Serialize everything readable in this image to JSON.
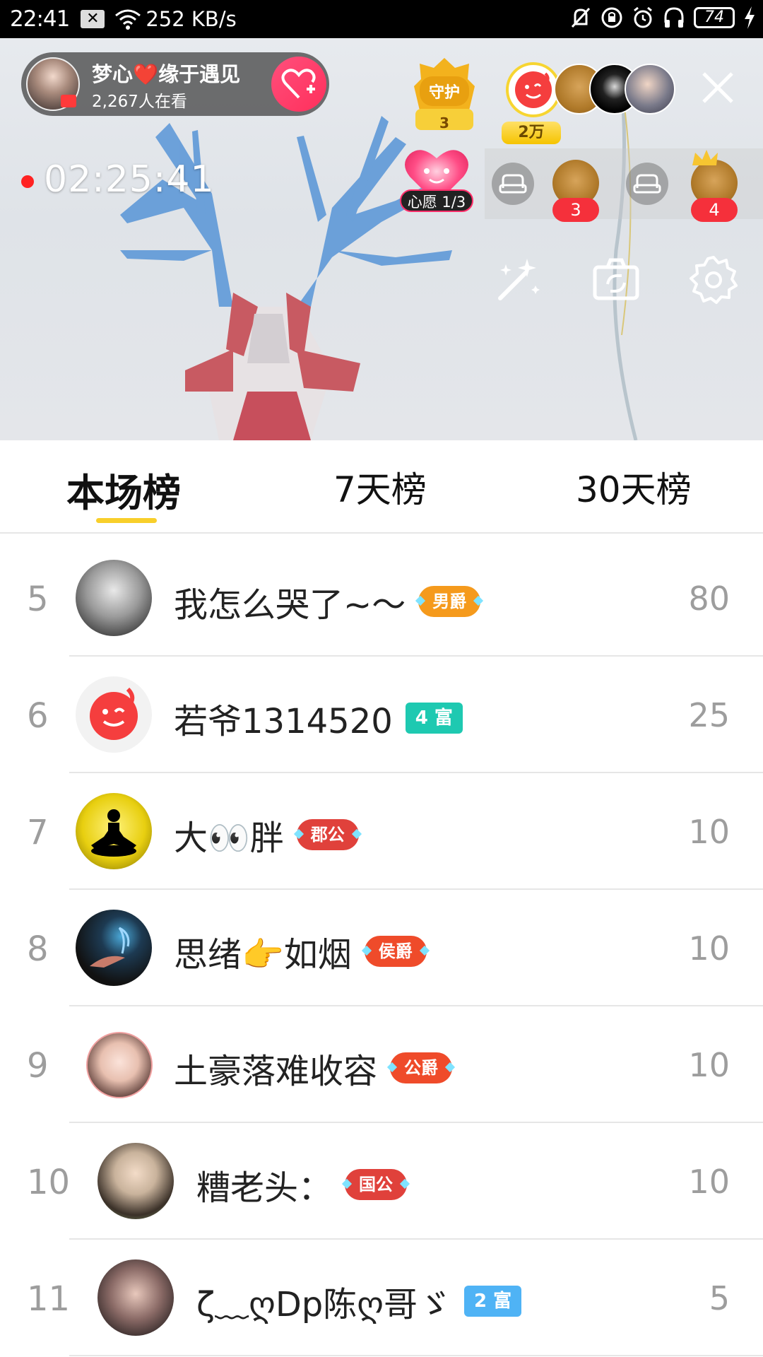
{
  "status_bar": {
    "time": "22:41",
    "network_speed": "252 KB/s",
    "battery": "74",
    "icons": [
      "close-notification-icon",
      "wifi-icon",
      "mute-icon",
      "lock-rotation-icon",
      "alarm-icon",
      "headphones-icon",
      "battery-icon",
      "charging-icon"
    ]
  },
  "live": {
    "host_name": "梦心❤️缘于遇见",
    "viewers": "2,267人在看",
    "guard": {
      "label": "守护",
      "count": "3"
    },
    "gift_tag": "2万",
    "timer": "02:25:41",
    "wish": "心愿 1/3",
    "seats": [
      {
        "type": "empty"
      },
      {
        "type": "user",
        "count": "3"
      },
      {
        "type": "empty"
      },
      {
        "type": "user",
        "count": "4"
      }
    ],
    "tools": [
      "magic-wand-icon",
      "camera-switch-icon",
      "settings-gear-icon"
    ]
  },
  "tabs": {
    "items": [
      "本场榜",
      "7天榜",
      "30天榜"
    ],
    "active_index": 0,
    "accent": "#f8cf2b"
  },
  "ranking": [
    {
      "rank": "5",
      "name": "我怎么哭了~〜",
      "badge": "男爵",
      "badge_type": "title",
      "badge_color": "#f59a1c",
      "score": "80",
      "avatar": "old-man-beard"
    },
    {
      "rank": "6",
      "name": "若爷1314520",
      "badge": "4 富",
      "badge_type": "rich",
      "badge_color": "#1ec9b1",
      "score": "25",
      "avatar": "app-logo"
    },
    {
      "rank": "7",
      "name": "大👀胖",
      "badge": "郡公",
      "badge_type": "title",
      "badge_color": "#e0413b",
      "score": "10",
      "avatar": "meditation-moon"
    },
    {
      "rank": "8",
      "name": "思绪👉如烟",
      "badge": "侯爵",
      "badge_type": "title",
      "badge_color": "#ef4b2a",
      "score": "10",
      "avatar": "smoke-hand"
    },
    {
      "rank": "9",
      "name": "土豪落难收容",
      "badge": "公爵",
      "badge_type": "title",
      "badge_color": "#ef4b2a",
      "score": "10",
      "avatar": "girl-portrait"
    },
    {
      "rank": "10",
      "name": "糟老头：",
      "badge": "国公",
      "badge_type": "title",
      "badge_color": "#e0413b",
      "score": "10",
      "avatar": "boy-illustration"
    },
    {
      "rank": "11",
      "name": "ζ﹏ღDp陈ღ哥ゞ",
      "badge": "2 富",
      "badge_type": "rich",
      "badge_color": "#4fb3f5",
      "score": "5",
      "avatar": "girl-selfie"
    }
  ]
}
